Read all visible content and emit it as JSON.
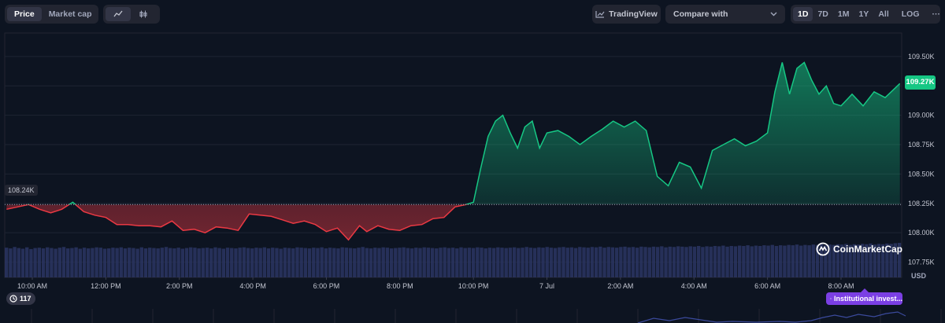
{
  "toolbar": {
    "view_tabs": [
      "Price",
      "Market cap"
    ],
    "active_view": "Price",
    "chart_type_icons": [
      "line-chart-icon",
      "candlestick-icon"
    ],
    "tradingview_label": "TradingView",
    "compare_label": "Compare with",
    "ranges": [
      "1D",
      "7D",
      "1M",
      "1Y",
      "All"
    ],
    "active_range": "1D",
    "log_label": "LOG",
    "more_label": "···"
  },
  "colors": {
    "up": "#16c784",
    "down": "#ea3943",
    "volume": "#2b3563",
    "background": "#0d1421",
    "badge_purple": "#7b3fe4"
  },
  "chart_data": {
    "type": "area",
    "title": "",
    "ylabel": "USD",
    "y_unit": "USD",
    "ylim": [
      107620,
      109700
    ],
    "y_ticks": [
      "109.50K",
      "109.25K",
      "109.00K",
      "108.75K",
      "108.50K",
      "108.25K",
      "108.00K",
      "107.75K"
    ],
    "y_tick_values": [
      109500,
      109250,
      109000,
      108750,
      108500,
      108250,
      108000,
      107750
    ],
    "x_ticks": [
      "10:00 AM",
      "12:00 PM",
      "2:00 PM",
      "4:00 PM",
      "6:00 PM",
      "8:00 PM",
      "10:00 PM",
      "7 Jul",
      "2:00 AM",
      "4:00 AM",
      "6:00 AM",
      "8:00 AM"
    ],
    "x_tick_hours": [
      10,
      12,
      14,
      16,
      18,
      20,
      22,
      24,
      26,
      28,
      30,
      32
    ],
    "x_range_hours": [
      9.25,
      33.65
    ],
    "reference_price": 108240,
    "reference_label": "108.24K",
    "current_price_label": "109.27K",
    "series": [
      {
        "x": [
          9.3,
          9.6,
          9.9,
          10.2,
          10.5,
          10.8,
          11.1,
          11.4,
          11.7,
          12.0,
          12.3,
          12.6,
          12.9,
          13.2,
          13.5,
          13.8,
          14.1,
          14.4,
          14.7,
          15.0,
          15.3,
          15.6,
          15.9,
          16.2,
          16.5,
          16.8,
          17.1,
          17.4,
          17.7,
          18.0,
          18.3,
          18.6,
          18.9,
          19.1,
          19.4,
          19.7,
          20.0,
          20.3,
          20.6,
          20.9,
          21.2,
          21.5,
          21.8,
          22.0,
          22.2,
          22.4,
          22.6,
          22.8,
          23.0,
          23.2,
          23.4,
          23.6,
          23.8,
          24.0,
          24.3,
          24.6,
          24.9,
          25.2,
          25.5,
          25.8,
          26.1,
          26.4,
          26.7,
          27.0,
          27.3,
          27.6,
          27.9,
          28.2,
          28.5,
          28.8,
          29.1,
          29.4,
          29.7,
          30.0,
          30.2,
          30.4,
          30.6,
          30.8,
          31.0,
          31.2,
          31.4,
          31.6,
          31.8,
          32.0,
          32.3,
          32.6,
          32.9,
          33.2,
          33.5,
          33.6
        ],
        "y": [
          108200,
          108220,
          108240,
          108200,
          108170,
          108200,
          108260,
          108180,
          108150,
          108130,
          108070,
          108070,
          108060,
          108060,
          108050,
          108100,
          108020,
          108030,
          108000,
          108050,
          108040,
          108020,
          108160,
          108150,
          108140,
          108110,
          108080,
          108100,
          108070,
          108010,
          108040,
          107940,
          108060,
          108010,
          108060,
          108030,
          108020,
          108060,
          108070,
          108120,
          108130,
          108220,
          108240,
          108260,
          108550,
          108820,
          108950,
          109000,
          108850,
          108720,
          108900,
          108950,
          108720,
          108850,
          108870,
          108820,
          108750,
          108820,
          108880,
          108950,
          108900,
          108950,
          108870,
          108480,
          108400,
          108600,
          108560,
          108380,
          108700,
          108750,
          108800,
          108740,
          108780,
          108850,
          109200,
          109450,
          109180,
          109400,
          109450,
          109300,
          109180,
          109250,
          109100,
          109080,
          109180,
          109080,
          109200,
          109150,
          109240,
          109270
        ]
      }
    ],
    "volume": {
      "count": 215,
      "values": [
        0.86,
        0.84,
        0.88,
        0.85,
        0.83,
        0.87,
        0.82,
        0.85,
        0.86,
        0.84,
        0.87,
        0.85,
        0.83,
        0.86,
        0.88,
        0.84,
        0.85,
        0.87,
        0.83,
        0.86,
        0.84,
        0.85,
        0.87,
        0.86,
        0.83,
        0.84,
        0.86,
        0.85,
        0.87,
        0.84,
        0.86,
        0.85,
        0.83,
        0.87,
        0.84,
        0.86,
        0.85,
        0.84,
        0.86,
        0.88,
        0.85,
        0.84,
        0.86,
        0.83,
        0.85,
        0.87,
        0.86,
        0.84,
        0.85,
        0.86,
        0.84,
        0.87,
        0.85,
        0.83,
        0.86,
        0.85,
        0.84,
        0.86,
        0.87,
        0.85,
        0.84,
        0.86,
        0.85,
        0.87,
        0.84,
        0.86,
        0.85,
        0.83,
        0.86,
        0.85,
        0.84,
        0.87,
        0.86,
        0.85,
        0.84,
        0.86,
        0.85,
        0.87,
        0.84,
        0.86,
        0.85,
        0.84,
        0.87,
        0.86,
        0.85,
        0.84,
        0.86,
        0.88,
        0.85,
        0.84,
        0.86,
        0.85,
        0.87,
        0.86,
        0.84,
        0.85,
        0.86,
        0.87,
        0.85,
        0.84,
        0.86,
        0.85,
        0.87,
        0.86,
        0.85,
        0.84,
        0.86,
        0.87,
        0.85,
        0.86,
        0.84,
        0.87,
        0.85,
        0.86,
        0.85,
        0.87,
        0.86,
        0.84,
        0.86,
        0.85,
        0.87,
        0.86,
        0.85,
        0.86,
        0.87,
        0.85,
        0.86,
        0.88,
        0.86,
        0.85,
        0.87,
        0.86,
        0.88,
        0.86,
        0.85,
        0.87,
        0.88,
        0.86,
        0.87,
        0.85,
        0.88,
        0.87,
        0.86,
        0.88,
        0.87,
        0.89,
        0.86,
        0.88,
        0.87,
        0.86,
        0.88,
        0.89,
        0.87,
        0.88,
        0.86,
        0.89,
        0.88,
        0.87,
        0.89,
        0.88,
        0.9,
        0.87,
        0.89,
        0.88,
        0.9,
        0.89,
        0.88,
        0.9,
        0.89,
        0.91,
        0.88,
        0.9,
        0.89,
        0.91,
        0.9,
        0.92,
        0.89,
        0.91,
        0.9,
        0.92,
        0.91,
        0.93,
        0.9,
        0.92,
        0.91,
        0.93,
        0.92,
        0.94,
        0.91,
        0.93,
        0.92,
        0.94,
        0.93,
        0.95,
        0.92,
        0.94,
        0.93,
        0.95,
        0.94,
        0.96,
        0.93,
        0.95,
        0.94,
        0.96,
        0.95,
        0.97,
        0.94,
        0.96,
        0.95,
        0.97,
        0.96,
        0.98,
        0.95,
        0.97,
        0.96,
        0.98,
        0.97,
        0.99,
        1.0
      ]
    }
  },
  "watermark": "CoinMarketCap",
  "news_count": "117",
  "institutional_label": "Institutional invest..."
}
